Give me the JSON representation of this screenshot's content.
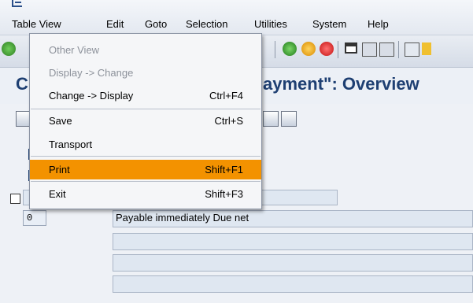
{
  "menubar": {
    "items": [
      {
        "label": "Table View"
      },
      {
        "label": "Edit"
      },
      {
        "label": "Goto"
      },
      {
        "label": "Selection"
      },
      {
        "label": "Utilities"
      },
      {
        "label": "System"
      },
      {
        "label": "Help"
      }
    ]
  },
  "title": {
    "left": "C",
    "right": "ayment\": Overview"
  },
  "dropdown": {
    "items": [
      {
        "label": "Other View",
        "shortcut": "",
        "state": "disabled"
      },
      {
        "label": "Display -> Change",
        "shortcut": "",
        "state": "disabled"
      },
      {
        "label": "Change -> Display",
        "shortcut": "Ctrl+F4",
        "state": "enabled"
      },
      {
        "label": "Save",
        "shortcut": "Ctrl+S",
        "state": "enabled"
      },
      {
        "label": "Transport",
        "shortcut": "",
        "state": "enabled"
      },
      {
        "label": "Print",
        "shortcut": "Shift+F1",
        "state": "highlighted"
      },
      {
        "label": "Exit",
        "shortcut": "Shift+F3",
        "state": "enabled"
      }
    ]
  },
  "table": {
    "rows": [
      {
        "key": "0",
        "text": "Payable immediately Due net"
      }
    ]
  },
  "colors": {
    "highlight": "#f39200",
    "title": "#1e3f72"
  }
}
